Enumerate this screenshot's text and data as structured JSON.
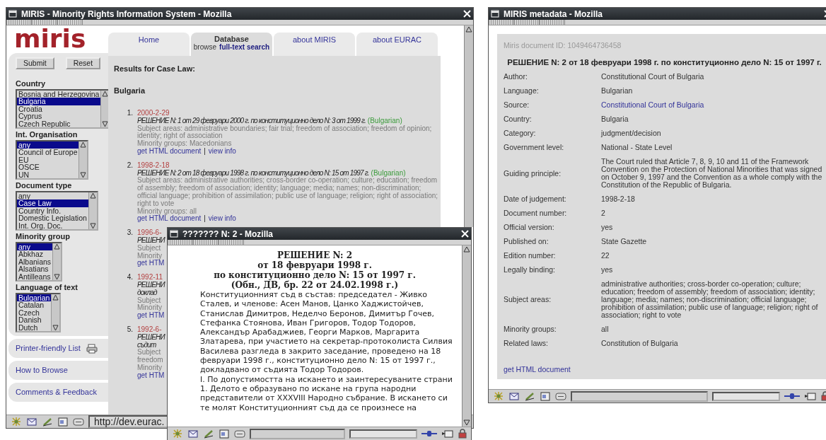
{
  "results_window": {
    "title": "MIRIS - Minority Rights Information System - Mozilla",
    "logo": "miris",
    "form_buttons": [
      "Submit",
      "Reset"
    ],
    "filters": [
      {
        "label": "Country",
        "options": [
          {
            "label": "Bosnia and Herzegovina",
            "selected": false
          },
          {
            "label": "Bulgaria",
            "selected": true
          },
          {
            "label": "Croatia",
            "selected": false
          },
          {
            "label": "Cyprus",
            "selected": false
          },
          {
            "label": "Czech Republic",
            "selected": false
          }
        ]
      },
      {
        "label": "Int. Organisation",
        "options": [
          {
            "label": "any",
            "selected": true
          },
          {
            "label": "Council of Europe",
            "selected": false
          },
          {
            "label": "EU",
            "selected": false
          },
          {
            "label": "OSCE",
            "selected": false
          },
          {
            "label": "UN",
            "selected": false
          }
        ]
      },
      {
        "label": "Document type",
        "options": [
          {
            "label": "any",
            "selected": false
          },
          {
            "label": "Case Law",
            "selected": true
          },
          {
            "label": "Country Info.",
            "selected": false
          },
          {
            "label": "Domestic Legislation",
            "selected": false
          },
          {
            "label": "Int. Org. Doc.",
            "selected": false
          }
        ]
      },
      {
        "label": "Minority group",
        "options": [
          {
            "label": "any",
            "selected": true
          },
          {
            "label": "Abkhaz",
            "selected": false
          },
          {
            "label": "Albanians",
            "selected": false
          },
          {
            "label": "Alsatians",
            "selected": false
          },
          {
            "label": "Antilleans",
            "selected": false
          }
        ]
      },
      {
        "label": "Language of text",
        "options": [
          {
            "label": "Bulgarian",
            "selected": true
          },
          {
            "label": "Catalan",
            "selected": false
          },
          {
            "label": "Czech",
            "selected": false
          },
          {
            "label": "Danish",
            "selected": false
          },
          {
            "label": "Dutch",
            "selected": false
          }
        ]
      }
    ],
    "sidebar_links": [
      {
        "label": "Printer-friendly List",
        "kind": "print"
      },
      {
        "label": "How to Browse",
        "kind": "plain"
      },
      {
        "label": "Comments & Feedback",
        "kind": "plain"
      }
    ],
    "tabs": [
      {
        "label": "Home",
        "selected": false
      },
      {
        "label": "Database",
        "selected": true,
        "sub_links": [
          {
            "label": "browse",
            "selected": true
          },
          {
            "label": "full-text search",
            "selected": false
          }
        ]
      },
      {
        "label": "about MIRIS",
        "selected": false
      },
      {
        "label": "about EURAC",
        "selected": false
      }
    ],
    "results_heading": "Results for Case Law:",
    "country_heading": "Bulgaria",
    "results": [
      {
        "number": "1.",
        "date": "2000-2-29",
        "title_lines": [
          "РЕШЕНИЕ N: 1 от 29 февруари 2000 г. по конституционно дело N: 3 от 1999 г."
        ],
        "language": "(Bulgarian)",
        "lines": [
          "Subject areas: administrative boundaries; fair trial; freedom of association; freedom of opinion; identity; right of association",
          "Minority groups: Macedonians"
        ],
        "links": [
          "get HTML document",
          "view info"
        ],
        "separator": "|"
      },
      {
        "number": "2.",
        "date": "1998-2-18",
        "title_lines": [
          "РЕШЕНИЕ N: 2 от 18 февруари 1998 г. по конституционно дело N: 15 от 1997 г."
        ],
        "language": "(Bulgarian)",
        "lines": [
          "Subject areas: administrative authorities; cross-border co-operation; culture; education; freedom of assembly; freedom of association; identity; language; media; names; non-discrimination; official language; prohibition of assimilation; public use of language; religion; right of association; right to vote",
          "Minority groups: all"
        ],
        "links": [
          "get HTML document",
          "view info"
        ],
        "separator": "|"
      },
      {
        "number": "3.",
        "date": "1996-6-",
        "title_lines": [
          "РЕШЕНИ"
        ],
        "lines": [
          "Subject",
          "Minority"
        ],
        "links": [
          "get HTM"
        ]
      },
      {
        "number": "4.",
        "date": "1992-11",
        "title_lines": [
          "РЕШЕНИ",
          "доклад"
        ],
        "lines": [
          "Subject",
          "Minority"
        ],
        "links": [
          "get HTM"
        ]
      },
      {
        "number": "5.",
        "date": "1992-6-",
        "title_lines": [
          "РЕШЕНИ",
          "съдит"
        ],
        "lines": [
          "Subject",
          "freedom",
          "Minority"
        ],
        "links": [
          "get HTM"
        ]
      }
    ],
    "status_url": "http://dev.eurac."
  },
  "metadata_window": {
    "title": "MIRIS metadata - Mozilla",
    "document_id": "Miris document ID: 1049464736458",
    "heading": "РЕШЕНИЕ N: 2 от 18 февруари 1998 г. по конституционно дело N: 15 от 1997 г.",
    "fields": [
      {
        "label": "Author:",
        "value": "Constitutional Court of Bulgaria",
        "kind": "text"
      },
      {
        "label": "Language:",
        "value": "Bulgarian",
        "kind": "text"
      },
      {
        "label": "Source:",
        "value": "Constitutional Court of Bulgaria",
        "kind": "link"
      },
      {
        "label": "Country:",
        "value": "Bulgaria",
        "kind": "text"
      },
      {
        "label": "Category:",
        "value": "judgment/decision",
        "kind": "text"
      },
      {
        "label": "Government level:",
        "value": "National - State Level",
        "kind": "text"
      },
      {
        "label": "Guiding principle:",
        "value": "The Court ruled that Article 7, 8, 9, 10 and 11 of the Framework Convention on the Protection of National Minorities that was signed on October 9, 1997 and the Convention as a whole comply with the Constitution of the Republic of Bulgaria.",
        "kind": "text"
      },
      {
        "label": "Date of judgement:",
        "value": "1998-2-18",
        "kind": "text"
      },
      {
        "label": "Document number:",
        "value": "2",
        "kind": "text"
      },
      {
        "label": "Official version:",
        "value": "yes",
        "kind": "text"
      },
      {
        "label": "Published on:",
        "value": "State Gazette",
        "kind": "text"
      },
      {
        "label": "Edition number:",
        "value": "22",
        "kind": "text"
      },
      {
        "label": "Legally binding:",
        "value": "yes",
        "kind": "text"
      },
      {
        "label": "Subject areas:",
        "value": "administrative authorities; cross-border co-operation; culture; education; freedom of assembly; freedom of association; identity; language; media; names; non-discrimination; official language; prohibition of assimilation; public use of language; religion; right of association; right to vote",
        "kind": "text"
      },
      {
        "label": "Minority groups:",
        "value": "all",
        "kind": "text"
      },
      {
        "label": "Related laws:",
        "value": "Constitution of Bulgaria",
        "kind": "text"
      }
    ],
    "document_link": "get HTML document"
  },
  "document_window": {
    "title": "??????? N: 2 - Mozilla",
    "heading_lines": [
      "РЕШЕНИЕ N: 2",
      "от 18 февруари 1998 г.",
      "по конституционно дело N: 15 от 1997 г.",
      "(Обн., ДВ, бр. 22 от 24.02.1998 г.)"
    ],
    "paragraphs": [
      "Конституционният съд в състав: председател - Живко Сталев, и членове: Асен Манов, Цанко Хаджистойчев, Станислав Димитров, Неделчо Беронов, Димитър Гочев, Стефанка Стоянова, Иван Григоров, Тодор Тодоров, Александър Арабаджиев, Георги Марков, Маргарита Златарева, при участието на секретар-протоколиста Силвия Василева разгледа в закрито заседание, проведено на 18 февруари 1998 г., конституционно дело N: 15 от 1997 г., докладвано от съдията Тодор Тодоров.",
      "I. По допустимостта на искането и заинтересуваните страни",
      "1. Делото е образувано по искане на група народни представители от XXXVIII Народно събрание. В искането си те молят Конституционният съд да се произнесе на"
    ]
  }
}
